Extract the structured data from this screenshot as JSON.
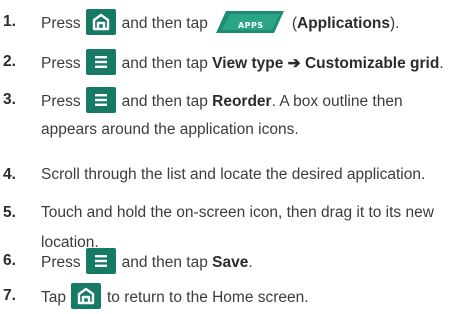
{
  "steps": [
    {
      "number": "1.",
      "parts": {
        "a": "Press",
        "b": "and then tap",
        "c": "(",
        "d": "Applications",
        "e": ")."
      }
    },
    {
      "number": "2.",
      "parts": {
        "a": "Press",
        "b": "and then tap",
        "c": "View type ➔ Customizable grid",
        "d": "."
      }
    },
    {
      "number": "3.",
      "parts": {
        "a": "Press",
        "b": "and then tap",
        "c": "Reorder",
        "d": ". A box outline then",
        "e": "appears around the application icons."
      }
    },
    {
      "number": "4.",
      "text": "Scroll through the list and locate the desired application."
    },
    {
      "number": "5.",
      "line1": "Touch and hold the on-screen icon, then drag it to its new",
      "line2": "location."
    },
    {
      "number": "6.",
      "parts": {
        "a": "Press",
        "b": "and then tap",
        "c": "Save",
        "d": "."
      }
    },
    {
      "number": "7.",
      "parts": {
        "a": "Tap",
        "b": "to return to the Home screen."
      }
    }
  ],
  "icons": {
    "home": "home-key-icon",
    "menu": "menu-key-icon",
    "apps": "apps-tab-icon",
    "apps_label": "APPS"
  },
  "colors": {
    "key_bg": "#167a64",
    "apps_tab": "#1c8d72"
  }
}
